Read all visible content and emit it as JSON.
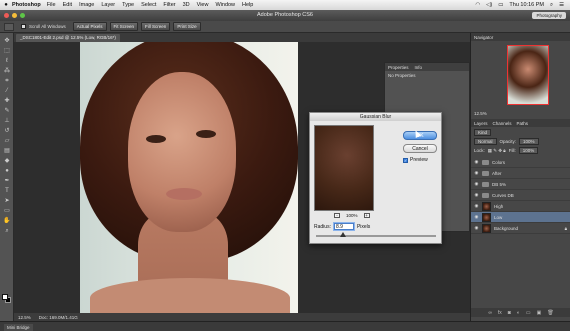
{
  "menubar": {
    "apple": "",
    "app_name": "Photoshop",
    "items": [
      "File",
      "Edit",
      "Image",
      "Layer",
      "Type",
      "Select",
      "Filter",
      "3D",
      "View",
      "Window",
      "Help"
    ],
    "clock": "Thu 10:16 PM"
  },
  "window": {
    "title": "Adobe Photoshop CS6",
    "workspace": "Photography"
  },
  "options": {
    "scroll_all_label": "Scroll All Windows",
    "actual_pixels": "Actual Pixels",
    "fit_screen": "Fit Screen",
    "fill_screen": "Fill Screen",
    "print_size": "Print Size"
  },
  "document": {
    "tab_label": "_DSC1801-Edit 2.psd @ 12.5% (Low, RGB/16*)",
    "zoom": "12.5%",
    "doc_info": "Doc: 169.0M/1.41G"
  },
  "properties": {
    "tabs": [
      "Properties",
      "Info"
    ],
    "body": "No Properties"
  },
  "dialog": {
    "title": "Gaussian Blur",
    "ok": "OK",
    "cancel": "Cancel",
    "preview": "Preview",
    "zoom_pct": "100%",
    "zoom_out": "-",
    "zoom_in": "+",
    "radius_label": "Radius:",
    "radius_value": "8.9",
    "radius_unit": "Pixels"
  },
  "navigator": {
    "title": "Navigator",
    "zoom": "12.5%"
  },
  "layers": {
    "tabs": [
      "Layers",
      "Channels",
      "Paths"
    ],
    "kind": "Kind",
    "blend": "Normal",
    "opacity_label": "Opacity:",
    "opacity": "100%",
    "lock_label": "Lock:",
    "fill_label": "Fill:",
    "fill": "100%",
    "items": [
      {
        "name": "Colors",
        "type": "group"
      },
      {
        "name": "After",
        "type": "group"
      },
      {
        "name": "DB 5%",
        "type": "group"
      },
      {
        "name": "Curves DB",
        "type": "group"
      },
      {
        "name": "High",
        "type": "layer"
      },
      {
        "name": "Low",
        "type": "layer",
        "active": true
      },
      {
        "name": "Background",
        "type": "layer"
      }
    ]
  },
  "bottom": {
    "mini_bridge": "Mini Bridge"
  }
}
